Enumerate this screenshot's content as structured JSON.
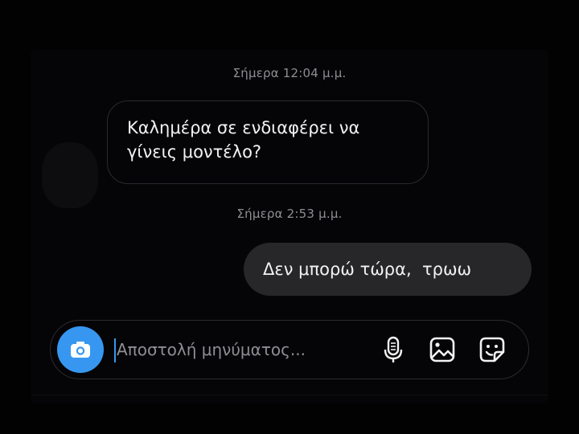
{
  "conversation": {
    "timestamps": [
      "Σήμερα 12:04 μ.μ.",
      "Σήμερα 2:53 μ.μ."
    ],
    "messages": [
      {
        "direction": "incoming",
        "text": "Καλημέρα σε ενδιαφέρει να γίνεις μοντέλο?"
      },
      {
        "direction": "outgoing",
        "text": "Δεν μπορώ τώρα,  τρωω"
      }
    ]
  },
  "composer": {
    "placeholder": "Αποστολή μηνύματος...",
    "value": "",
    "icons": [
      "camera-icon",
      "microphone-icon",
      "gallery-icon",
      "sticker-icon"
    ]
  },
  "colors": {
    "background": "#020203",
    "accent": "#3797f0",
    "outgoing_bubble": "#27272a",
    "text": "#f2f2f2",
    "muted_text": "#8e8e93"
  }
}
